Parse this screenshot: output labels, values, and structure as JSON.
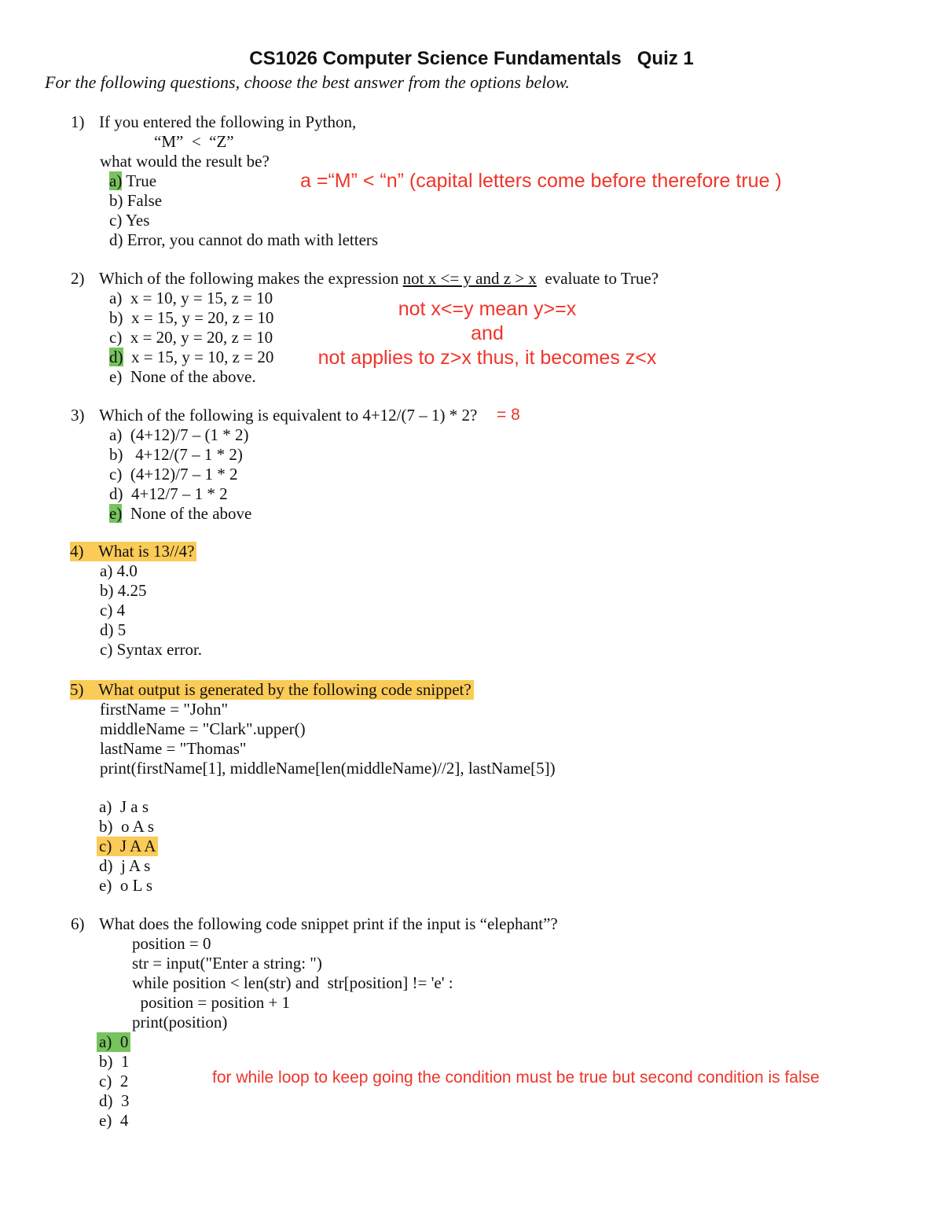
{
  "header": {
    "title": "CS1026 Computer Science Fundamentals   Quiz 1",
    "instructions": "For the following questions, choose the best answer from the options below."
  },
  "colors": {
    "annotation": "#f0342a",
    "correct_highlight": "#77c35e",
    "question_highlight": "#fbcb57"
  },
  "questions": [
    {
      "number": "1)",
      "text": "If you entered the following in Python,",
      "code": [
        "“M”  <  “Z”"
      ],
      "prompt": "what would the result be?",
      "options": [
        {
          "label": "a)",
          "text": "True",
          "highlight": "green"
        },
        {
          "label": "b)",
          "text": "False"
        },
        {
          "label": "c)",
          "text": "Yes"
        },
        {
          "label": "d)",
          "text": "Error, you cannot do math with letters"
        }
      ],
      "annotations": [
        "a =“M” < “n” (capital letters come before therefore true )"
      ]
    },
    {
      "number": "2)",
      "text_before": "Which of the following makes the expression ",
      "text_underlined": "not x <= y and z > x",
      "text_after": "  evaluate to True?",
      "options": [
        {
          "label": "a)",
          "text": "x = 10, y = 15, z = 10"
        },
        {
          "label": "b)",
          "text": "x = 15, y = 20, z = 10"
        },
        {
          "label": "c)",
          "text": "x = 20, y = 20, z = 10"
        },
        {
          "label": "d)",
          "text": "x = 15, y = 10, z = 20",
          "highlight": "green"
        },
        {
          "label": "e)",
          "text": "None of the above."
        }
      ],
      "annotations": [
        "not x<=y mean y>=x",
        "and",
        "not applies to z>x thus, it becomes z<x"
      ]
    },
    {
      "number": "3)",
      "text": "Which of the following is equivalent to 4+12/(7 – 1) * 2?",
      "options": [
        {
          "label": "a)",
          "text": "(4+12)/7 – (1 * 2)"
        },
        {
          "label": "b)",
          "text": " 4+12/(7 – 1 * 2)"
        },
        {
          "label": "c)",
          "text": "(4+12)/7 – 1 * 2"
        },
        {
          "label": "d)",
          "text": "4+12/7 – 1 * 2"
        },
        {
          "label": "e)",
          "text": "None of the above",
          "highlight": "green"
        }
      ],
      "annotations": [
        "= 8"
      ]
    },
    {
      "number": "4)",
      "text": "What is 13//4?",
      "highlight": "yellow",
      "options": [
        {
          "label": "a)",
          "text": "4.0"
        },
        {
          "label": "b)",
          "text": "4.25"
        },
        {
          "label": "c)",
          "text": "4"
        },
        {
          "label": "d)",
          "text": "5"
        },
        {
          "label": "c)",
          "text": "Syntax error."
        }
      ]
    },
    {
      "number": "5)",
      "text": "What output is generated by the following code snippet?",
      "highlight": "yellow",
      "code": [
        "firstName = \"John\"",
        "middleName = \"Clark\".upper()",
        "lastName = \"Thomas\"",
        "print(firstName[1], middleName[len(middleName)//2], lastName[5])"
      ],
      "options": [
        {
          "label": "a)",
          "text": "J a s"
        },
        {
          "label": "b)",
          "text": "o A s"
        },
        {
          "label": "c)",
          "text": "J A A",
          "highlight": "yellow"
        },
        {
          "label": "d)",
          "text": "j A s"
        },
        {
          "label": "e)",
          "text": "o L s"
        }
      ]
    },
    {
      "number": "6)",
      "text": "What does the following code snippet print if the input is “elephant”?",
      "code": [
        "position = 0",
        "str = input(\"Enter a string: \")",
        "while position < len(str) and  str[position] != 'e' :",
        "  position = position + 1",
        "print(position)"
      ],
      "options": [
        {
          "label": "a)",
          "text": "0",
          "highlight": "green"
        },
        {
          "label": "b)",
          "text": "1"
        },
        {
          "label": "c)",
          "text": "2"
        },
        {
          "label": "d)",
          "text": "3"
        },
        {
          "label": "e)",
          "text": "4"
        }
      ],
      "annotations": [
        "for while loop to keep going the condition must be true but second condition is false"
      ]
    }
  ]
}
